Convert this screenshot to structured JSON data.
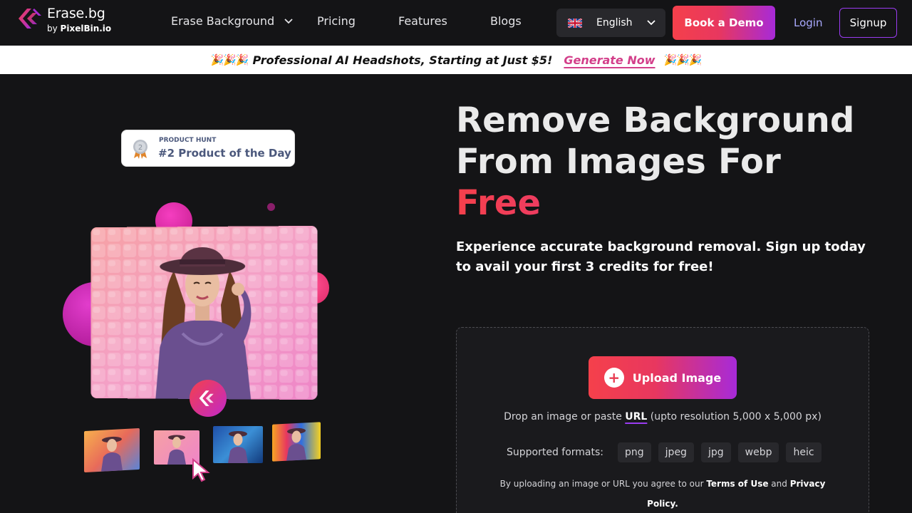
{
  "nav": {
    "logo_title": "Erase.bg",
    "logo_by": "by",
    "logo_brand": "PixelBin.io",
    "links": [
      "Erase Background",
      "Pricing",
      "Features",
      "Blogs"
    ],
    "language": "English",
    "book_demo": "Book a Demo",
    "login": "Login",
    "signup": "Signup"
  },
  "promo": {
    "emoji_left": "🎉🎉🎉",
    "text": "Professional AI Headshots, Starting at Just $5!",
    "cta": "Generate Now",
    "emoji_right": "🎉🎉🎉"
  },
  "badge": {
    "medal_number": "2",
    "label": "PRODUCT HUNT",
    "title": "#2 Product of the Day"
  },
  "hero": {
    "title_line1": "Remove Background",
    "title_line2": "From Images For",
    "title_free": "Free",
    "subtitle": "Experience accurate background removal. Sign up today to avail your first 3 credits for free!"
  },
  "upload": {
    "button": "Upload Image",
    "hint_before": "Drop an image or paste",
    "hint_url": "URL",
    "hint_after": "(upto resolution 5,000 x 5,000 px)",
    "formats_label": "Supported formats:",
    "formats": [
      "png",
      "jpeg",
      "jpg",
      "webp",
      "heic"
    ],
    "legal_before": "By uploading an image or URL you agree to our",
    "terms": "Terms of Use",
    "legal_and": "and",
    "privacy": "Privacy Policy."
  },
  "colors": {
    "accent_start": "#f5404b",
    "accent_end": "#a72ad8",
    "background": "#141416"
  }
}
